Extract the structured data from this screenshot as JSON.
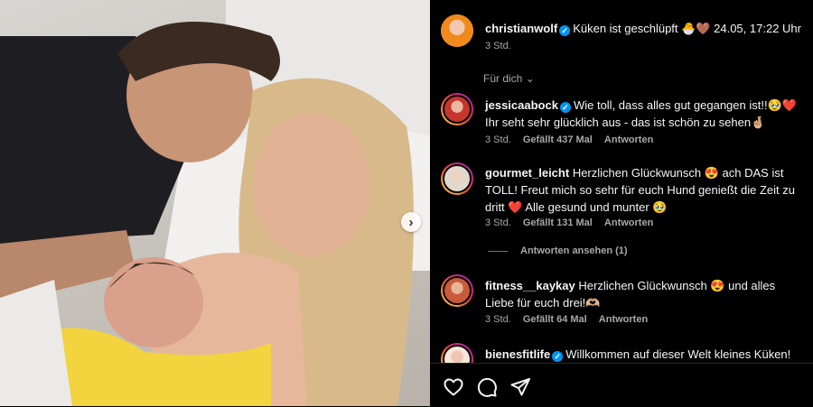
{
  "post": {
    "username": "christianwolf",
    "caption": "Küken ist geschlüpft 🐣🤎 24.05, 17:22 Uhr",
    "age": "3 Std."
  },
  "filter_label": "Für dich",
  "comments": [
    {
      "username": "jessicaabock",
      "verified": true,
      "text": "Wie toll, dass alles gut gegangen ist!!🥹❤️ Ihr seht sehr glücklich aus - das ist schön zu sehen🤞🏼",
      "age": "3 Std.",
      "likes": "Gefällt 437 Mal",
      "reply": "Antworten"
    },
    {
      "username": "gourmet_leicht",
      "verified": false,
      "text": "Herzlichen Glückwunsch 😍  ach DAS ist TOLL! Freut mich so sehr für euch Hund genießt die Zeit zu dritt ❤️  Alle gesund und munter 🥹",
      "age": "3 Std.",
      "likes": "Gefällt 131 Mal",
      "reply": "Antworten",
      "view_replies": "Antworten ansehen (1)"
    },
    {
      "username": "fitness__kaykay",
      "verified": false,
      "text": "Herzlichen Glückwunsch 😍  und alles Liebe für euch drei!🫶🏼",
      "age": "3 Std.",
      "likes": "Gefällt 64 Mal",
      "reply": "Antworten"
    },
    {
      "username": "bienesfitlife",
      "verified": true,
      "text": "Willkommen auf dieser Welt kleines Küken!"
    }
  ],
  "icons": {
    "like": "heart-icon",
    "comment": "comment-icon",
    "share": "share-icon",
    "next": "chevron-right-icon"
  }
}
